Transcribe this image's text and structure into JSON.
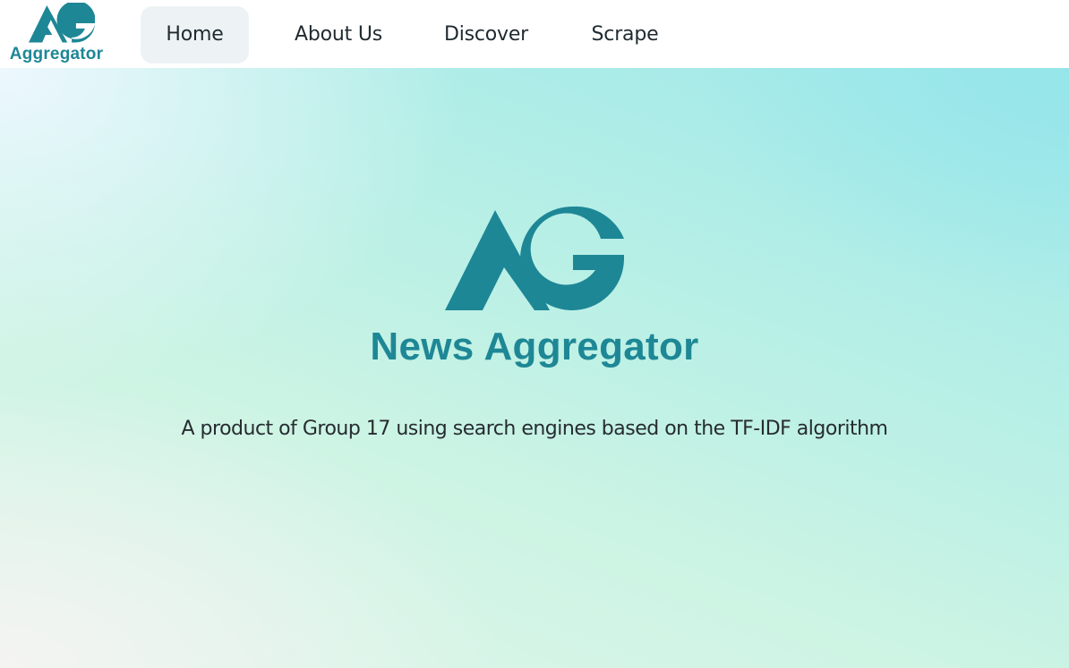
{
  "colors": {
    "brand": "#1e8796",
    "nav_active_background": "#edf3f5",
    "text": "#262c30"
  },
  "navbar": {
    "logo": {
      "icon": "ag-logo-icon",
      "name": "Aggregator"
    },
    "items": [
      {
        "label": "Home",
        "active": true
      },
      {
        "label": "About Us",
        "active": false
      },
      {
        "label": "Discover",
        "active": false
      },
      {
        "label": "Scrape",
        "active": false
      }
    ]
  },
  "hero": {
    "logo_icon": "ag-logo-icon",
    "title": "News Aggregator",
    "subtitle": "A product of Group 17 using search engines based on the TF-IDF algorithm"
  }
}
